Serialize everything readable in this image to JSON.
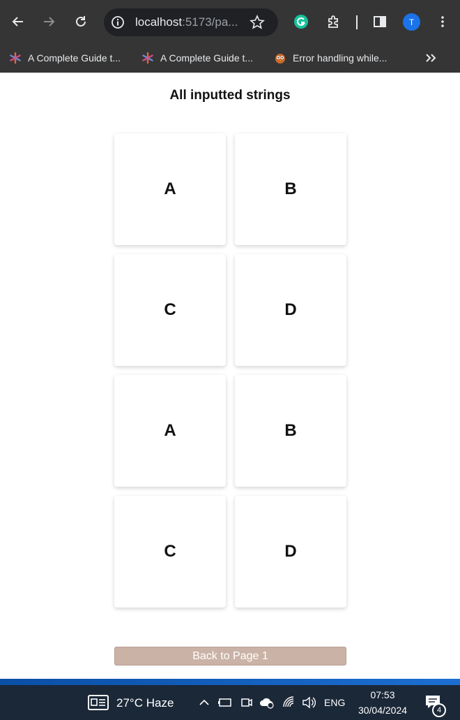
{
  "browser": {
    "url_host": "localhost",
    "url_rest": ":5173/pa...",
    "profile_initial": "T",
    "bookmarks": [
      {
        "label": "A Complete Guide t..."
      },
      {
        "label": "A Complete Guide t..."
      },
      {
        "label": "Error handling while..."
      }
    ]
  },
  "page": {
    "title": "All inputted strings",
    "cards": [
      {
        "label": "A"
      },
      {
        "label": "B"
      },
      {
        "label": "C"
      },
      {
        "label": "D"
      },
      {
        "label": "A"
      },
      {
        "label": "B"
      },
      {
        "label": "C"
      },
      {
        "label": "D"
      }
    ],
    "back_button": "Back to Page 1"
  },
  "taskbar": {
    "weather": "27°C  Haze",
    "language": "ENG",
    "time": "07:53",
    "date": "30/04/2024",
    "notification_count": "4"
  },
  "colors": {
    "chrome_bg": "#353535",
    "omnibox_bg": "#202124",
    "button_bg": "#cbb2a6",
    "taskbar_bg": "#1b2838",
    "profile_bg": "#1a73e8"
  }
}
